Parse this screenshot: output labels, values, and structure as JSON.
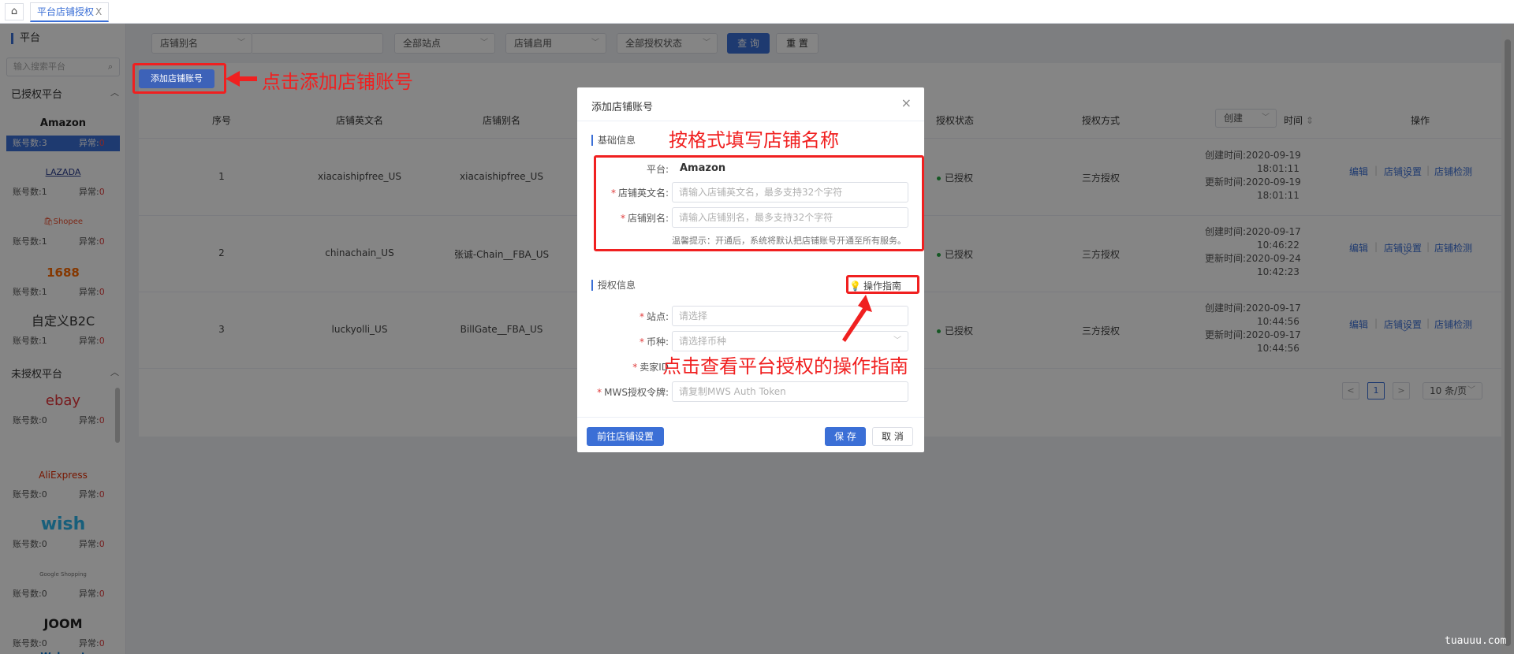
{
  "topbar": {
    "tab_label": "平台店铺授权",
    "tab_close": "X"
  },
  "sidebar": {
    "title": "平台",
    "search_placeholder": "输入搜索平台",
    "authorized_group": "已授权平台",
    "unauthorized_group": "未授权平台",
    "count_label": "账号数:",
    "error_label": "异常:",
    "platforms": [
      {
        "name": "Amazon",
        "accounts": "3",
        "errors": "0",
        "active": true
      },
      {
        "name": "LAZADA",
        "accounts": "1",
        "errors": "0"
      },
      {
        "name": "Shopee",
        "accounts": "1",
        "errors": "0"
      },
      {
        "name": "1688",
        "accounts": "1",
        "errors": "0"
      },
      {
        "name": "自定义B2C",
        "accounts": "1",
        "errors": "0"
      }
    ],
    "unauth_platforms": [
      {
        "name": "ebay",
        "accounts": "0",
        "errors": "0"
      },
      {
        "name": "AliExpress",
        "accounts": "0",
        "errors": "0"
      },
      {
        "name": "wish",
        "accounts": "0",
        "errors": "0"
      },
      {
        "name": "Google Shopping",
        "accounts": "0",
        "errors": "0"
      },
      {
        "name": "JOOM",
        "accounts": "0",
        "errors": "0"
      },
      {
        "name": "Walmart",
        "accounts": "",
        "errors": ""
      }
    ]
  },
  "filters": {
    "alias_select": "店铺别名",
    "all_sites": "全部站点",
    "shop_enabled": "店铺启用",
    "all_auth_status": "全部授权状态",
    "query_button": "查 询",
    "reset_button": "重 置",
    "add_button": "添加店铺账号"
  },
  "table": {
    "headers": {
      "index": "序号",
      "en_name": "店铺英文名",
      "alias": "店铺别名",
      "auth_status": "授权状态",
      "auth_method": "授权方式",
      "sort_select": "创建",
      "time": "时间",
      "ops": "操作"
    },
    "rows": [
      {
        "index": "1",
        "en_name": "xiacaishipfree_US",
        "alias": "xiacaishipfree_US",
        "status": "已授权",
        "method": "三方授权",
        "created_label": "创建时间:",
        "created_date": "2020-09-19",
        "created_time": "18:01:11",
        "updated_label": "更新时间:",
        "updated_date": "2020-09-19",
        "updated_time": "18:01:11"
      },
      {
        "index": "2",
        "en_name": "chinachain_US",
        "alias": "张诚-Chain__FBA_US",
        "status": "已授权",
        "method": "三方授权",
        "created_label": "创建时间:",
        "created_date": "2020-09-17",
        "created_time": "10:46:22",
        "updated_label": "更新时间:",
        "updated_date": "2020-09-24",
        "updated_time": "10:42:23"
      },
      {
        "index": "3",
        "en_name": "luckyolli_US",
        "alias": "BillGate__FBA_US",
        "status": "已授权",
        "method": "三方授权",
        "created_label": "创建时间:",
        "created_date": "2020-09-17",
        "created_time": "10:44:56",
        "updated_label": "更新时间:",
        "updated_date": "2020-09-17",
        "updated_time": "10:44:56"
      }
    ],
    "ops": {
      "edit": "编辑",
      "settings": "店铺设置",
      "check": "店铺检测"
    },
    "pagination": {
      "prev": "<",
      "page": "1",
      "next": ">",
      "page_size": "10 条/页"
    }
  },
  "dialog": {
    "title": "添加店铺账号",
    "basic_section": "基础信息",
    "platform_label": "平台:",
    "platform_value": "Amazon",
    "en_name_label": "店铺英文名:",
    "en_name_placeholder": "请输入店铺英文名，最多支持32个字符",
    "alias_label": "店铺别名:",
    "alias_placeholder": "请输入店铺别名，最多支持32个字符",
    "hint": "温馨提示：开通后，系统将默认把店铺账号开通至所有服务。",
    "auth_section": "授权信息",
    "guide_link": "操作指南",
    "site_label": "站点:",
    "site_placeholder": "请选择",
    "currency_label": "币种:",
    "currency_placeholder": "请选择币种",
    "seller_label": "卖家ID",
    "mws_label": "MWS授权令牌:",
    "mws_placeholder": "请复制MWS Auth Token",
    "goto_settings": "前往店铺设置",
    "save": "保 存",
    "cancel": "取 消"
  },
  "annotations": {
    "add_account": "点击添加店铺账号",
    "fill_name": "按格式填写店铺名称",
    "view_guide": "点击查看平台授权的操作指南"
  },
  "watermark": "tuauuu.com",
  "colors": {
    "accent": "#3b6fd6",
    "annotation": "#f02020",
    "success": "#27a844"
  }
}
